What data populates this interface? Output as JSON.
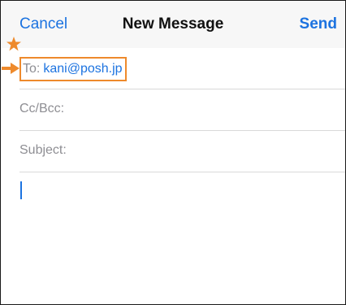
{
  "header": {
    "cancel_label": "Cancel",
    "title": "New Message",
    "send_label": "Send"
  },
  "fields": {
    "to_label": "To:",
    "to_value": "kani@posh.jp",
    "cc_label": "Cc/Bcc:",
    "subject_label": "Subject:"
  },
  "annotation": {
    "highlight_color": "#ee8a2c",
    "marker_icons": [
      "star-icon",
      "arrow-right-icon"
    ]
  },
  "colors": {
    "accent": "#1c73e0",
    "label": "#8e8e93"
  }
}
